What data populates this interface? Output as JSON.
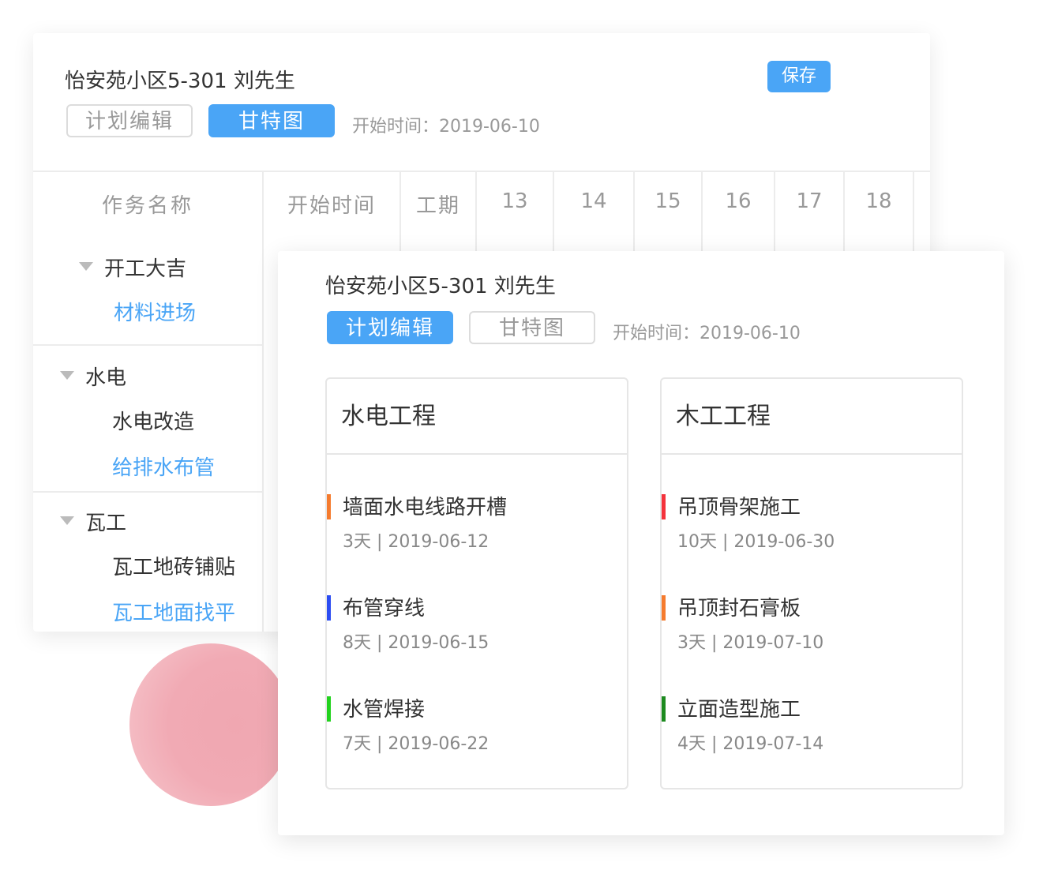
{
  "gantt": {
    "title": "怡安苑小区5-301 刘先生",
    "save_label": "保存",
    "tab_plan": "计划编辑",
    "tab_gantt": "甘特图",
    "start_info": "开始时间：2019-06-10",
    "headers": [
      "作务名称",
      "开始时间",
      "工期",
      "13",
      "14",
      "15",
      "16",
      "17",
      "18"
    ],
    "groups": [
      {
        "label": "开工大吉",
        "items": [
          "材料进场"
        ]
      },
      {
        "label": "水电",
        "items": [
          "水电改造",
          "给排水布管"
        ]
      },
      {
        "label": "瓦工",
        "items": [
          "瓦工地砖铺贴",
          "瓦工地面找平"
        ]
      }
    ]
  },
  "plan": {
    "title": "怡安苑小区5-301 刘先生",
    "tab_plan": "计划编辑",
    "tab_gantt": "甘特图",
    "start_info": "开始时间：2019-06-10",
    "panels": [
      {
        "title": "水电工程",
        "tasks": [
          {
            "name": "墙面水电线路开槽",
            "meta": "3天 | 2019-06-12",
            "color": "#f57b2e"
          },
          {
            "name": "布管穿线",
            "meta": "8天 | 2019-06-15",
            "color": "#2b4cf2"
          },
          {
            "name": "水管焊接",
            "meta": "7天 | 2019-06-22",
            "color": "#22d21e"
          }
        ]
      },
      {
        "title": "木工工程",
        "tasks": [
          {
            "name": "吊顶骨架施工",
            "meta": "10天 | 2019-06-30",
            "color": "#f4333c"
          },
          {
            "name": "吊顶封石膏板",
            "meta": "3天 | 2019-07-10",
            "color": "#f57b2e"
          },
          {
            "name": "立面造型施工",
            "meta": "4天 | 2019-07-14",
            "color": "#1d8a1f"
          }
        ]
      }
    ]
  },
  "colors": {
    "accent": "#4aa5f6",
    "decor_blob": "#f0a7b1"
  }
}
